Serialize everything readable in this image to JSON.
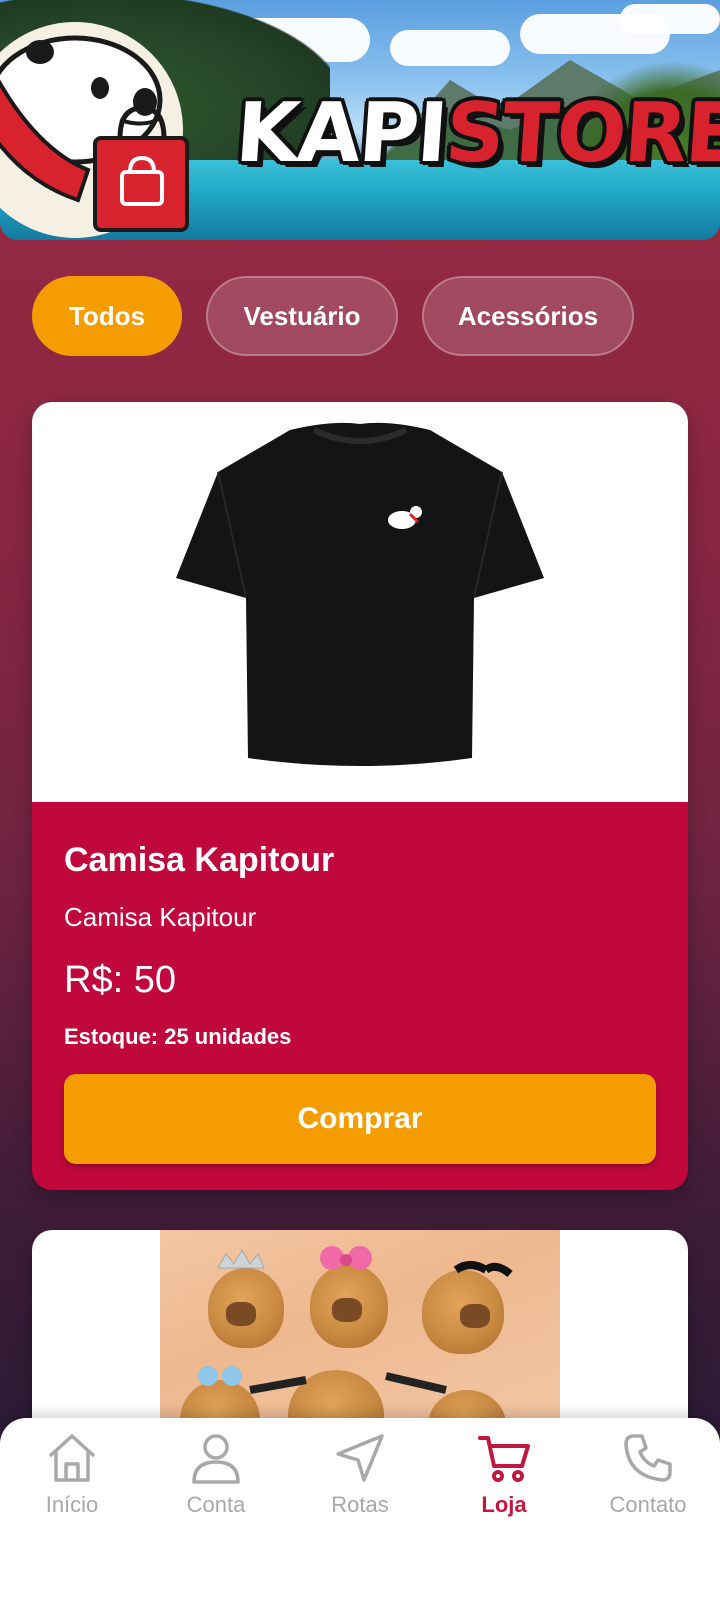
{
  "banner": {
    "logo_part1": "KAPI",
    "logo_part2": "STORE"
  },
  "filters": [
    {
      "label": "Todos",
      "active": true
    },
    {
      "label": "Vestuário",
      "active": false
    },
    {
      "label": "Acessórios",
      "active": false
    }
  ],
  "products": [
    {
      "title": "Camisa Kapitour",
      "description": "Camisa Kapitour",
      "price": "R$: 50",
      "stock": "Estoque: 25 unidades",
      "button_label": "Comprar"
    }
  ],
  "nav": [
    {
      "label": "Início",
      "icon": "home-icon",
      "active": false
    },
    {
      "label": "Conta",
      "icon": "user-icon",
      "active": false
    },
    {
      "label": "Rotas",
      "icon": "navigation-arrow-icon",
      "active": false
    },
    {
      "label": "Loja",
      "icon": "cart-icon",
      "active": true
    },
    {
      "label": "Contato",
      "icon": "phone-icon",
      "active": false
    }
  ],
  "colors": {
    "accent": "#f59c00",
    "card_red": "#c0083d",
    "nav_active": "#c0183e",
    "nav_inactive": "#a8a8a8"
  }
}
